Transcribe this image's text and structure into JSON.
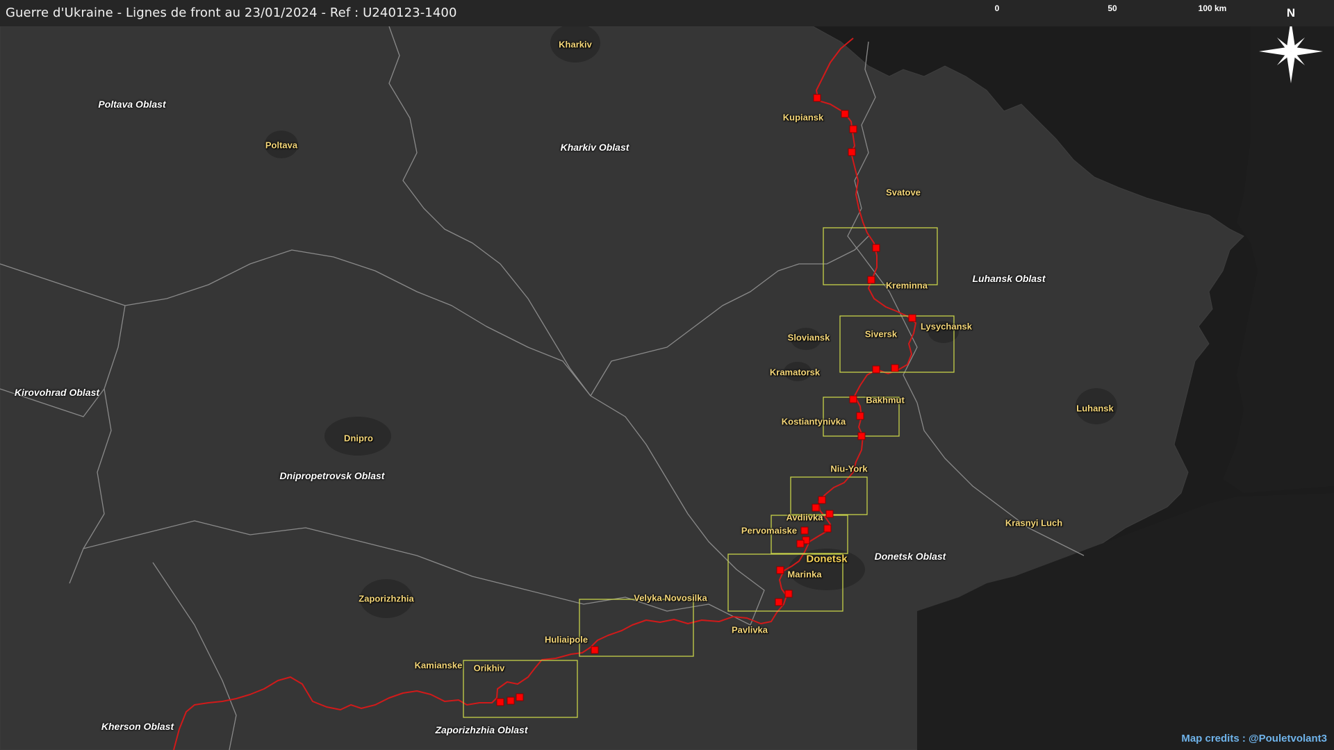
{
  "title": "Guerre d'Ukraine - Lignes de front au 23/01/2024 - Ref : U240123-1400",
  "scale": {
    "ticks": [
      "0",
      "50",
      "100 km"
    ]
  },
  "north_label": "N",
  "credits": "Map credits : @Pouletvolant3",
  "colors": {
    "background": "#1c1c1c",
    "land": "#363636",
    "border": "#8a8a8a",
    "front_line": "#d11a1a",
    "marker": "#ff0000",
    "box": "#c8d24a",
    "city_label": "#f5d77a"
  },
  "oblasts": [
    {
      "key": "poltava_oblast",
      "label": "Poltava Oblast"
    },
    {
      "key": "kharkiv_oblast",
      "label": "Kharkiv Oblast"
    },
    {
      "key": "luhansk_oblast",
      "label": "Luhansk Oblast"
    },
    {
      "key": "kirovohrad_oblast",
      "label": "Kirovohrad Oblast"
    },
    {
      "key": "dnipropetrovsk_oblast",
      "label": "Dnipropetrovsk Oblast"
    },
    {
      "key": "donetsk_oblast",
      "label": "Donetsk Oblast"
    },
    {
      "key": "kherson_oblast",
      "label": "Kherson Oblast"
    },
    {
      "key": "zaporizhzhia_oblast",
      "label": "Zaporizhzhia Oblast"
    }
  ],
  "cities": [
    {
      "key": "kharkiv",
      "label": "Kharkiv"
    },
    {
      "key": "kupiansk",
      "label": "Kupiansk"
    },
    {
      "key": "poltava",
      "label": "Poltava"
    },
    {
      "key": "svatove",
      "label": "Svatove"
    },
    {
      "key": "kreminna",
      "label": "Kreminna"
    },
    {
      "key": "lysychansk",
      "label": "Lysychansk"
    },
    {
      "key": "siversk",
      "label": "Siversk"
    },
    {
      "key": "sloviansk",
      "label": "Sloviansk"
    },
    {
      "key": "kramatorsk",
      "label": "Kramatorsk"
    },
    {
      "key": "bakhmut",
      "label": "Bakhmut"
    },
    {
      "key": "kostiantynivka",
      "label": "Kostiantynivka"
    },
    {
      "key": "luhansk",
      "label": "Luhansk"
    },
    {
      "key": "dnipro",
      "label": "Dnipro"
    },
    {
      "key": "niu_york",
      "label": "Niu-York"
    },
    {
      "key": "avdiivka",
      "label": "Avdiivka"
    },
    {
      "key": "pervomaiske",
      "label": "Pervomaiske"
    },
    {
      "key": "donetsk",
      "label": "Donetsk"
    },
    {
      "key": "marinka",
      "label": "Marinka"
    },
    {
      "key": "krasnyi_luch",
      "label": "Krasnyi Luch"
    },
    {
      "key": "zaporizhzhia",
      "label": "Zaporizhzhia"
    },
    {
      "key": "velyka_novosilka",
      "label": "Velyka Novosilka"
    },
    {
      "key": "pavlivka",
      "label": "Pavlivka"
    },
    {
      "key": "huliaipole",
      "label": "Huliaipole"
    },
    {
      "key": "kamianske",
      "label": "Kamianske"
    },
    {
      "key": "orikhiv",
      "label": "Orikhiv"
    }
  ]
}
